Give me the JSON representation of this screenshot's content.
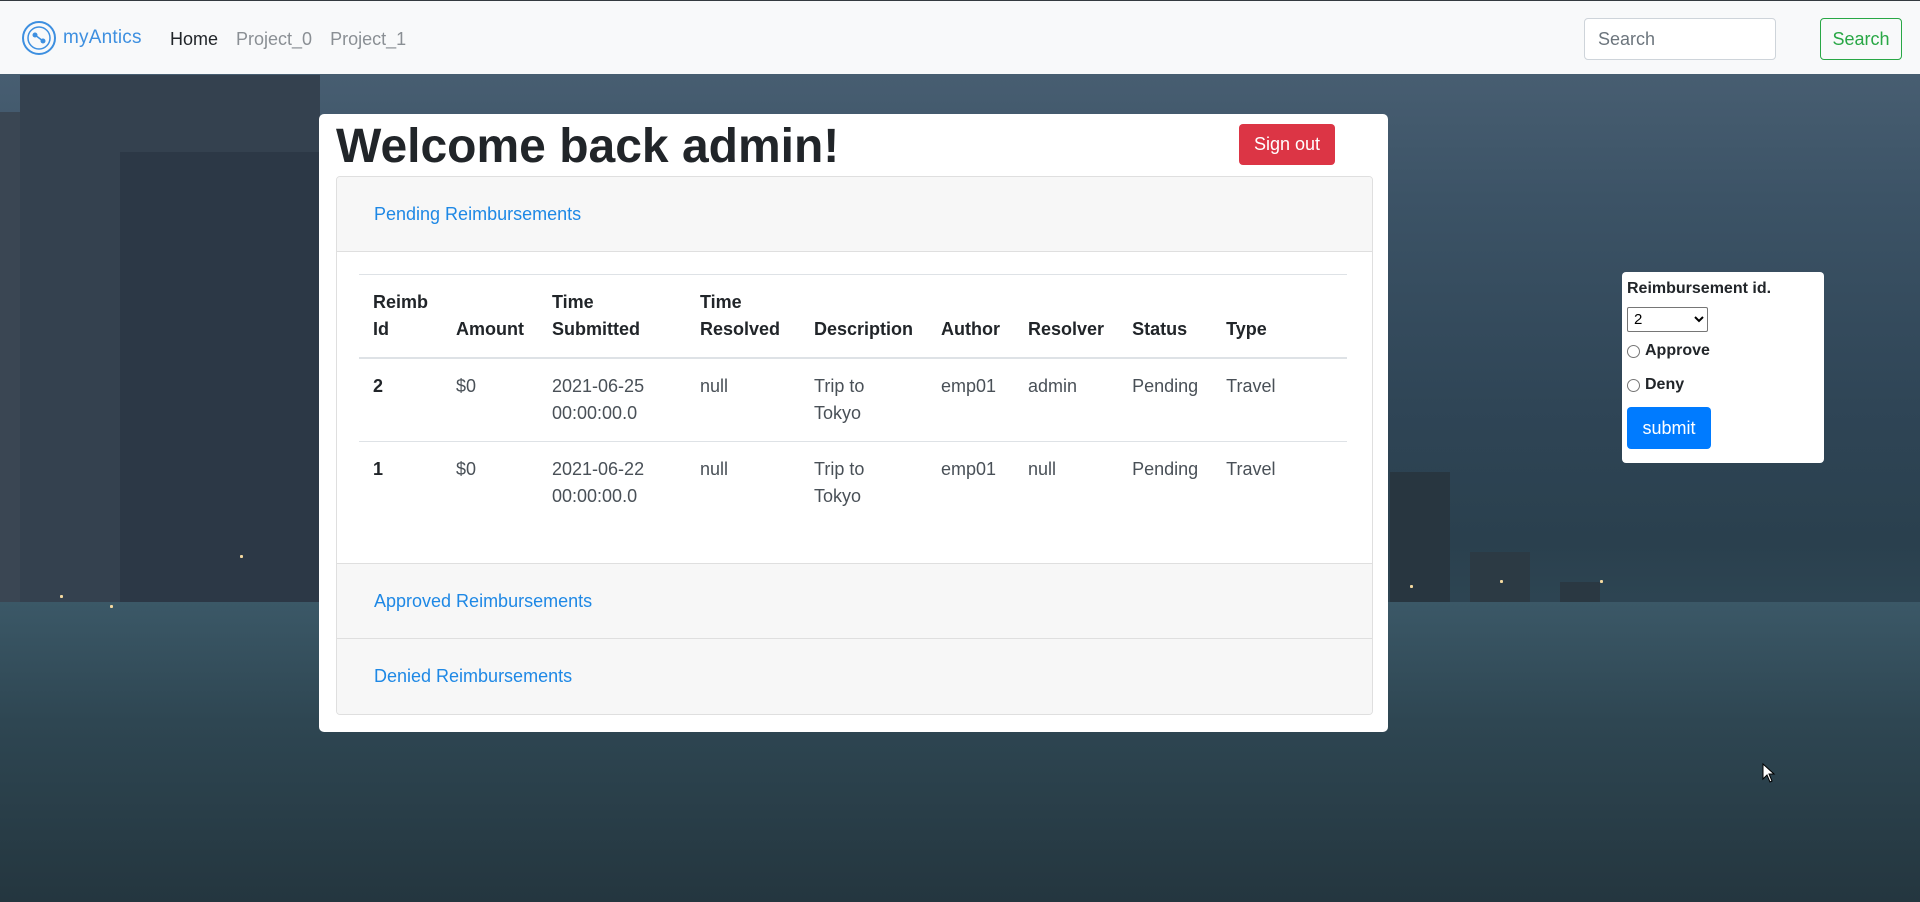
{
  "nav": {
    "brand": "myAntics",
    "links": [
      "Home",
      "Project_0",
      "Project_1"
    ],
    "search_placeholder": "Search",
    "search_button": "Search"
  },
  "main": {
    "welcome": "Welcome back admin!",
    "sign_out": "Sign out",
    "sections": {
      "pending": "Pending Reimbursements",
      "approved": "Approved Reimbursements",
      "denied": "Denied Reimbursements"
    },
    "table": {
      "headers": [
        "Reimb Id",
        "Amount",
        "Time Submitted",
        "Time Resolved",
        "Description",
        "Author",
        "Resolver",
        "Status",
        "Type"
      ],
      "rows": [
        [
          "2",
          "$0",
          "2021-06-25 00:00:00.0",
          "null",
          "Trip to Tokyo",
          "emp01",
          "admin",
          "Pending",
          "Travel"
        ],
        [
          "1",
          "$0",
          "2021-06-22 00:00:00.0",
          "null",
          "Trip to Tokyo",
          "emp01",
          "null",
          "Pending",
          "Travel"
        ]
      ]
    }
  },
  "side_form": {
    "label": "Reimbursement id.",
    "selected_id": "2",
    "approve": "Approve",
    "deny": "Deny",
    "submit": "submit"
  },
  "colors": {
    "sign_out": "#dc3545",
    "submit": "#007bff",
    "search_button": "#28a745",
    "link": "#1e88e5"
  }
}
